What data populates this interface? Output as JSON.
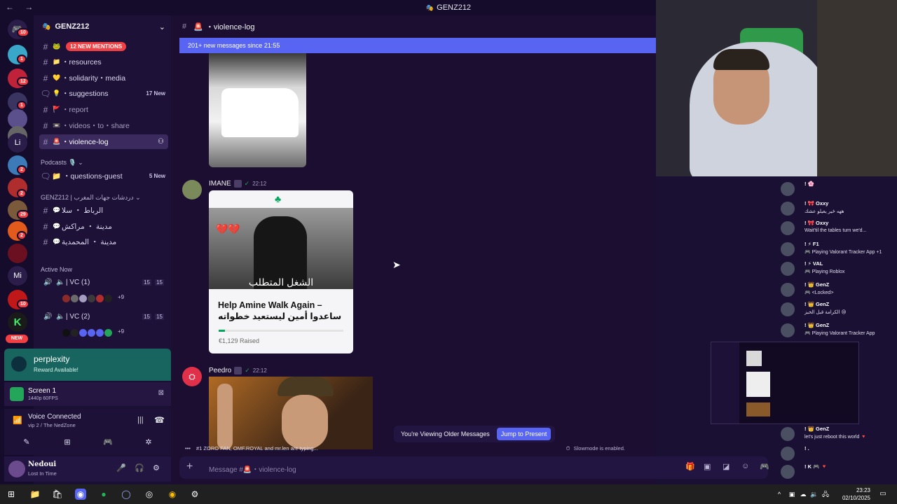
{
  "window": {
    "title": "GENZ212",
    "nav": "← →"
  },
  "server_badges": [
    "10",
    "1",
    "12",
    "1",
    "1",
    "2",
    "2",
    "2",
    "29",
    "2",
    "10"
  ],
  "server_misc": {
    "li": "Li",
    "mi": "Mi",
    "new_badge": "NEW"
  },
  "guild": {
    "name": "GENZ212",
    "chevron": "⌄"
  },
  "channels": [
    {
      "name": "12 NEW MENTIONS",
      "emoji": "🐸",
      "type": "mention"
    },
    {
      "name": "・resources",
      "emoji": "📁",
      "type": "text"
    },
    {
      "name": "・solidarity・media",
      "emoji": "💛",
      "type": "text"
    },
    {
      "name": "・suggestions",
      "emoji": "💡",
      "type": "forum",
      "badge": "17 New"
    },
    {
      "name": "・report",
      "emoji": "🚩",
      "type": "text"
    },
    {
      "name": "・videos・to・share",
      "emoji": "📼",
      "type": "text"
    },
    {
      "name": "・violence-log",
      "emoji": "🚨",
      "type": "text",
      "active": true
    }
  ],
  "podcasts": {
    "label": "Podcasts 🎙️ ⌄",
    "channel": "📁 ・questions-guest",
    "badge": "5 New"
  },
  "arabic_section": {
    "label": "GENZ212 | دردشات جهات المغرب ⌄"
  },
  "arabic_channels": [
    "الرباط ・ سلا",
    "مدينة ・ مراكش",
    "مدينة ・ المحمدية"
  ],
  "active_now": {
    "label": "Active Now",
    "rooms": [
      {
        "name": "| VC (1)",
        "count_a": "15",
        "count_b": "15",
        "more": "+9"
      },
      {
        "name": "| VC (2)",
        "count_a": "15",
        "count_b": "15",
        "more": "+9"
      }
    ]
  },
  "promo": {
    "name": "perplexity",
    "sub": "Reward Available!"
  },
  "screen": {
    "title": "Screen 1",
    "sub": "1440p 60FPS"
  },
  "voice": {
    "status": "Voice Connected",
    "room": "vip 2 / The NedZone"
  },
  "user": {
    "name": "Nedoui",
    "status": "Lost In Time"
  },
  "chat": {
    "channel": "・violence-log",
    "new_messages": "201+ new messages since 21:55",
    "messages": [
      {
        "author": "IMANE",
        "time": "22:12"
      },
      {
        "author": "Peedro",
        "time": "22:12"
      }
    ],
    "card": {
      "title": "Help Amine Walk Again – ساعدوا أمين ليستعيد خطواته",
      "raised": "€1,129 Raised",
      "progress": 0.05,
      "photo_caption": "الشغل المتطلب"
    },
    "viewing": "You're Viewing Older Messages",
    "jump": "Jump to Present",
    "typing": "#1 ZORO FAN, OMF.ROYAL and mr.len are typing...",
    "slowmode": "Slowmode is enabled.",
    "placeholder": "Message #🚨・violence-log"
  },
  "overlay": [
    {
      "name": "! 🌸",
      "msg": ""
    },
    {
      "name": "! 🎀 Oxxy",
      "msg": "ههه ځير يغيلو عشك"
    },
    {
      "name": "! 🎀 Oxxy",
      "msg": "Wait'til the tables turn we'd..."
    },
    {
      "name": "! ⚡ F1",
      "msg": "🎮 Playing Valorant Tracker App +1"
    },
    {
      "name": "! ⚡ VAL",
      "msg": "🎮 Playing Roblox"
    },
    {
      "name": "! 👑 GenZ",
      "msg": "🎮 <Locked>"
    },
    {
      "name": "! 👑 GenZ",
      "msg": "الكرامة قبل الخبز 😢"
    },
    {
      "name": "! 👑 GenZ",
      "msg": "🎮 Playing Valorant Tracker App"
    },
    {
      "name": "! 👑 GenZ",
      "msg": "let's just reboot this world 🔻"
    },
    {
      "name": "! .",
      "msg": ""
    },
    {
      "name": "! K 🎮 🔻",
      "msg": ""
    }
  ],
  "taskbar": {
    "time": "23:23",
    "date": "02/10/2025"
  }
}
